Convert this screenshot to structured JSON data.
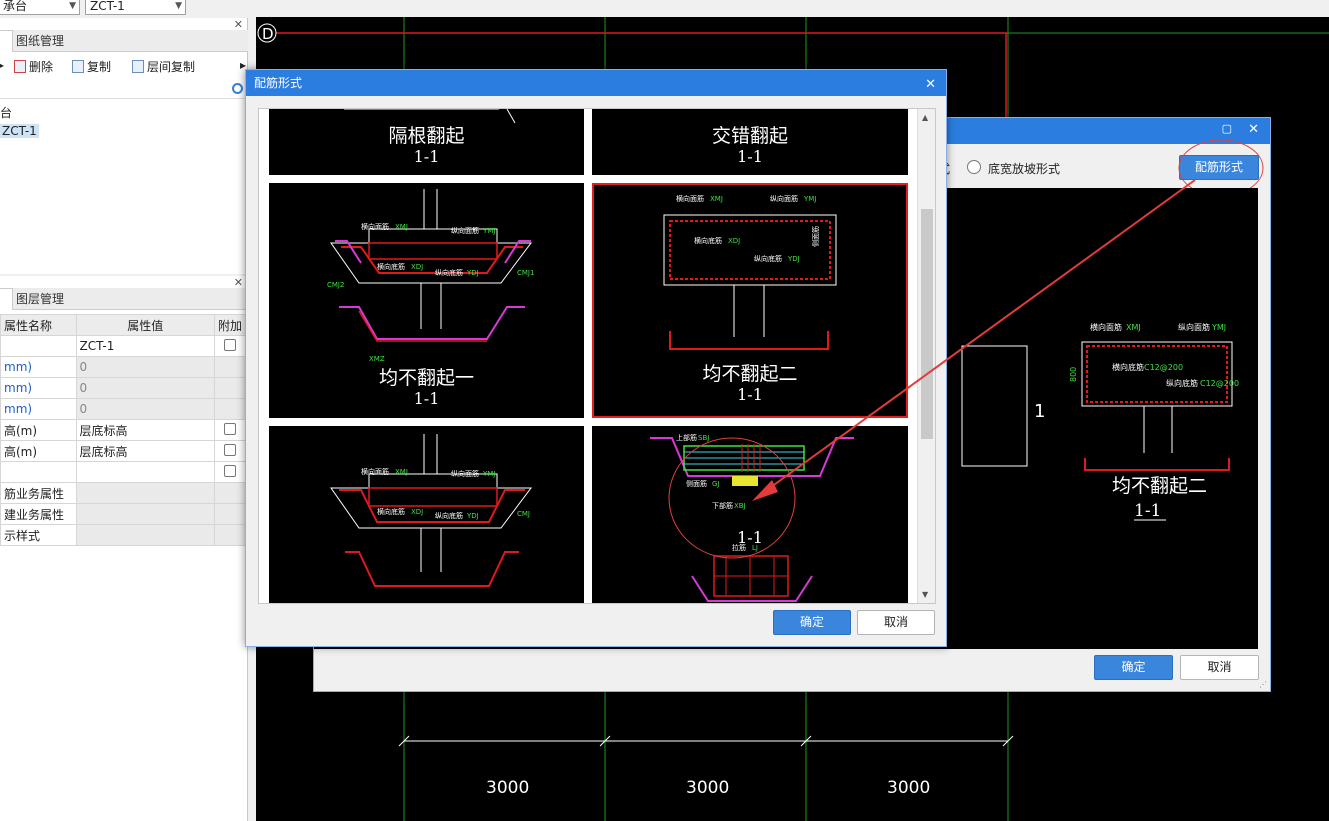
{
  "topbar": {
    "combo1_value": "承台",
    "combo2_value": "ZCT-1"
  },
  "left_top": {
    "tabs": [
      "",
      "图纸管理"
    ],
    "tools": {
      "delete": "删除",
      "copy": "复制",
      "floor_copy": "层间复制"
    },
    "search_prefix": "⌕",
    "tree": [
      "台",
      "ZCT-1"
    ]
  },
  "left_bottom": {
    "tabs": [
      "",
      "图层管理"
    ],
    "header": [
      "属性名称",
      "属性值",
      "附加"
    ],
    "rows": [
      {
        "name": "",
        "value": "ZCT-1",
        "gray": false,
        "blue": false,
        "check": true
      },
      {
        "name": "mm)",
        "value": "0",
        "gray": true,
        "blue": true,
        "check": false
      },
      {
        "name": "mm)",
        "value": "0",
        "gray": true,
        "blue": true,
        "check": false
      },
      {
        "name": "mm)",
        "value": "0",
        "gray": true,
        "blue": true,
        "check": false
      },
      {
        "name": "高(m)",
        "value": "层底标高",
        "gray": false,
        "blue": false,
        "check": true
      },
      {
        "name": "高(m)",
        "value": "层底标高",
        "gray": false,
        "blue": false,
        "check": true
      },
      {
        "name": "",
        "value": "",
        "gray": false,
        "blue": false,
        "check": true
      },
      {
        "name": "筋业务属性",
        "value": "",
        "gray": true,
        "blue": false,
        "check": false
      },
      {
        "name": "建业务属性",
        "value": "",
        "gray": true,
        "blue": false,
        "check": false
      },
      {
        "name": "示样式",
        "value": "",
        "gray": true,
        "blue": false,
        "check": false
      }
    ]
  },
  "cad": {
    "axis_label": "D",
    "dims": [
      "3000",
      "3000",
      "3000"
    ],
    "side_char": "台"
  },
  "dialog_back": {
    "radio_partial": "式",
    "radio_label": "底宽放坡形式",
    "button_label": "配筋形式",
    "ok": "确定",
    "cancel": "取消",
    "preview_number": "1",
    "preview_title": "均不翻起二",
    "preview_sub": "1-1",
    "preview_labels": {
      "h": "横向面筋",
      "v": "纵向面筋",
      "hb": "横向底筋",
      "vb": "纵向底筋",
      "side": "侧面筋",
      "hb_val": "C12@200",
      "vb_val": "C12@200",
      "h_val": "XMJ",
      "v_val": "YMJ",
      "height": "800"
    }
  },
  "dialog_front": {
    "title": "配筋形式",
    "ok": "确定",
    "cancel": "取消",
    "cells": [
      {
        "caption": "隔根翻起",
        "sub": "1-1"
      },
      {
        "caption": "交错翻起",
        "sub": "1-1"
      },
      {
        "caption": "均不翻起一",
        "sub": "1-1"
      },
      {
        "caption": "均不翻起二",
        "sub": "1-1"
      },
      {
        "caption": "",
        "sub": ""
      },
      {
        "caption": "",
        "sub": "1-1"
      }
    ],
    "labels": {
      "hm": "横向面筋",
      "vm": "纵向面筋",
      "hd": "横向底筋",
      "vd": "纵向底筋",
      "xmj": "XMJ",
      "ymj": "YMJ",
      "xdj": "XDJ",
      "ydj": "YDJ",
      "side": "侧面筋",
      "top_bar": "上部筋",
      "top_code": "SBJ",
      "bottom_bar": "下部筋",
      "bottom_code": "XBJ",
      "cmj": "CMJ",
      "cmj1": "CMJ1",
      "cmj2": "CMJ2",
      "xmz": "XMZ",
      "lzj": "拉筋",
      "lj_code": "LJ",
      "gj": "GJ"
    }
  }
}
